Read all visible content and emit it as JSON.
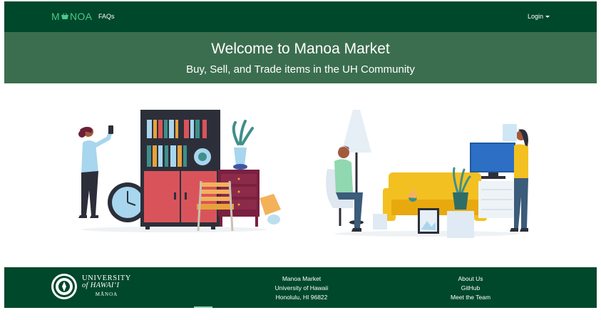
{
  "navbar": {
    "brand": "MANOA",
    "brand_left": "M",
    "brand_right": "NOA",
    "faqs": "FAQs",
    "login": "Login"
  },
  "hero": {
    "title": "Welcome to Manoa Market",
    "subtitle": "Buy, Sell, and Trade items in the UH Community"
  },
  "illustrations": [
    "woman-with-phone-and-furniture",
    "man-sitting-and-woman-with-tv"
  ],
  "footer": {
    "logo": {
      "line1": "UNIVERSITY",
      "line2": "of HAWAI‘I",
      "line3": "MĀNOA"
    },
    "address": [
      "Manoa Market",
      "University of Hawaii",
      "Honolulu, HI 96822"
    ],
    "links": [
      "About Us",
      "GitHub",
      "Meet the Team"
    ]
  },
  "colors": {
    "nav_bg": "#00482b",
    "hero_bg": "#3b6e4f",
    "brand": "#4cc88a"
  }
}
